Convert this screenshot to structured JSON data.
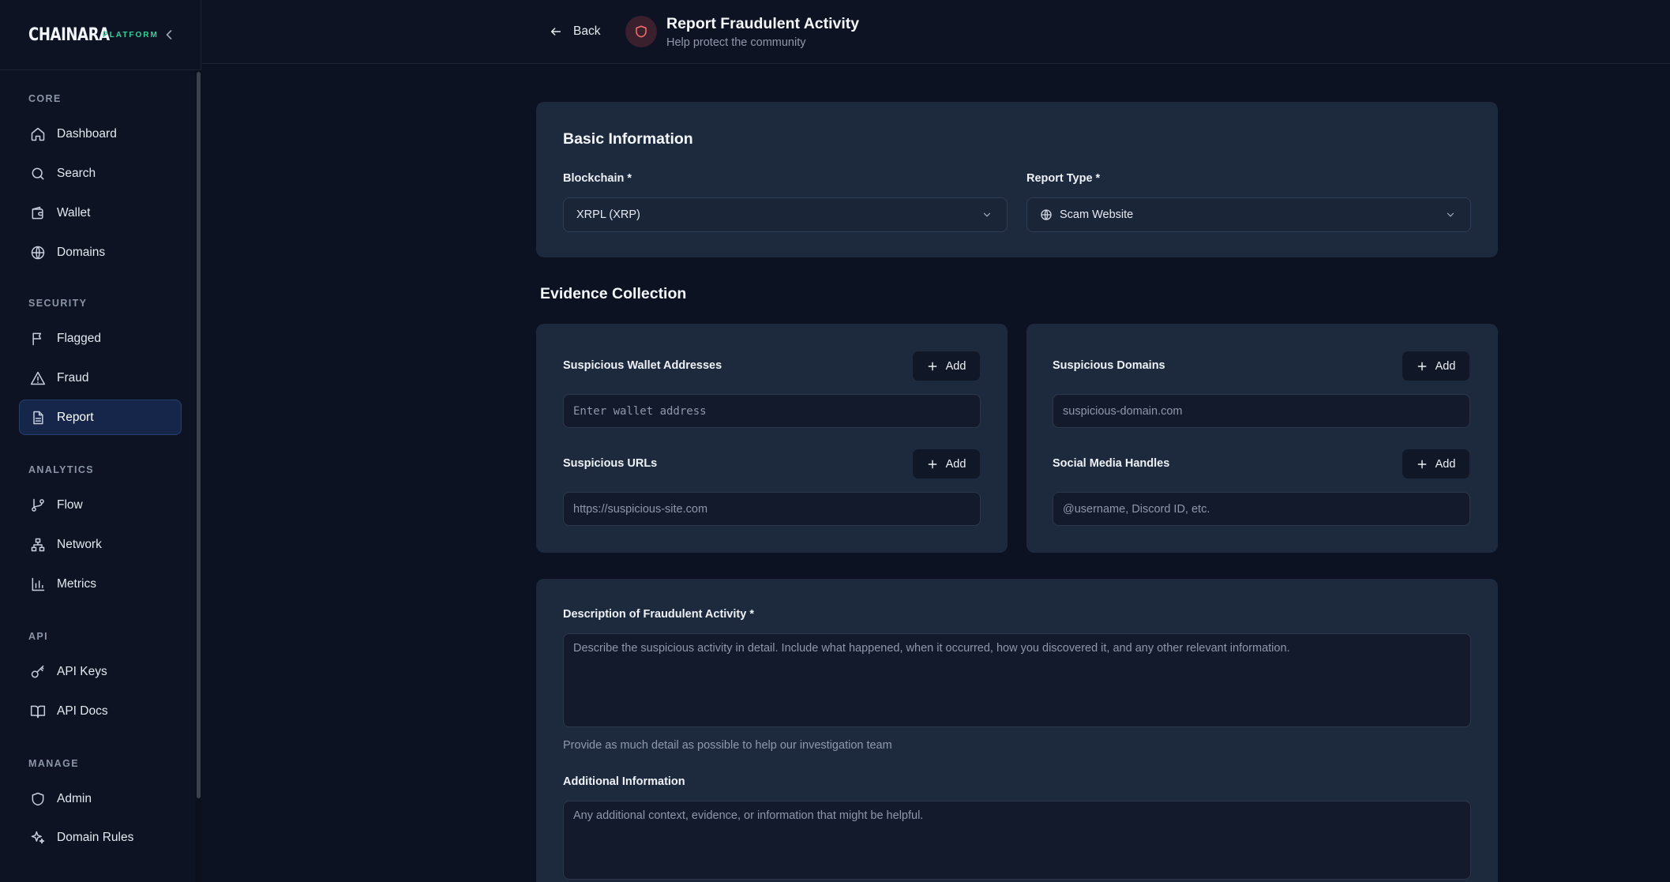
{
  "brand": {
    "name": "CHAINARA",
    "tag": "PLATFORM"
  },
  "sidebar": {
    "sections": [
      {
        "title": "CORE",
        "items": [
          {
            "label": "Dashboard",
            "icon": "home-icon"
          },
          {
            "label": "Search",
            "icon": "search-icon"
          },
          {
            "label": "Wallet",
            "icon": "wallet-icon"
          },
          {
            "label": "Domains",
            "icon": "globe-icon"
          }
        ]
      },
      {
        "title": "SECURITY",
        "items": [
          {
            "label": "Flagged",
            "icon": "flag-icon"
          },
          {
            "label": "Fraud",
            "icon": "warning-icon"
          },
          {
            "label": "Report",
            "icon": "document-icon",
            "active": true
          }
        ]
      },
      {
        "title": "ANALYTICS",
        "items": [
          {
            "label": "Flow",
            "icon": "git-branch-icon"
          },
          {
            "label": "Network",
            "icon": "network-icon"
          },
          {
            "label": "Metrics",
            "icon": "bar-chart-icon"
          }
        ]
      },
      {
        "title": "API",
        "items": [
          {
            "label": "API Keys",
            "icon": "key-icon"
          },
          {
            "label": "API Docs",
            "icon": "book-icon"
          }
        ]
      },
      {
        "title": "MANAGE",
        "items": [
          {
            "label": "Admin",
            "icon": "shield-icon"
          },
          {
            "label": "Domain Rules",
            "icon": "sparkles-icon"
          }
        ]
      }
    ]
  },
  "header": {
    "back_label": "Back",
    "title": "Report Fraudulent Activity",
    "subtitle": "Help protect the community"
  },
  "basic_info": {
    "title": "Basic Information",
    "blockchain_label": "Blockchain *",
    "blockchain_value": "XRPL (XRP)",
    "report_type_label": "Report Type *",
    "report_type_value": "Scam Website"
  },
  "evidence": {
    "title": "Evidence Collection",
    "add_label": "Add",
    "wallets_label": "Suspicious Wallet Addresses",
    "wallets_placeholder": "Enter wallet address",
    "urls_label": "Suspicious URLs",
    "urls_placeholder": "https://suspicious-site.com",
    "domains_label": "Suspicious Domains",
    "domains_placeholder": "suspicious-domain.com",
    "social_label": "Social Media Handles",
    "social_placeholder": "@username, Discord ID, etc."
  },
  "details": {
    "description_label": "Description of Fraudulent Activity *",
    "description_placeholder": "Describe the suspicious activity in detail. Include what happened, when it occurred, how you discovered it, and any other relevant information.",
    "description_hint": "Provide as much detail as possible to help our investigation team",
    "additional_label": "Additional Information",
    "additional_placeholder": "Any additional context, evidence, or information that might be helpful."
  },
  "colors": {
    "accent": "#34d399",
    "danger": "#f87171",
    "active_nav": "#15264a"
  }
}
